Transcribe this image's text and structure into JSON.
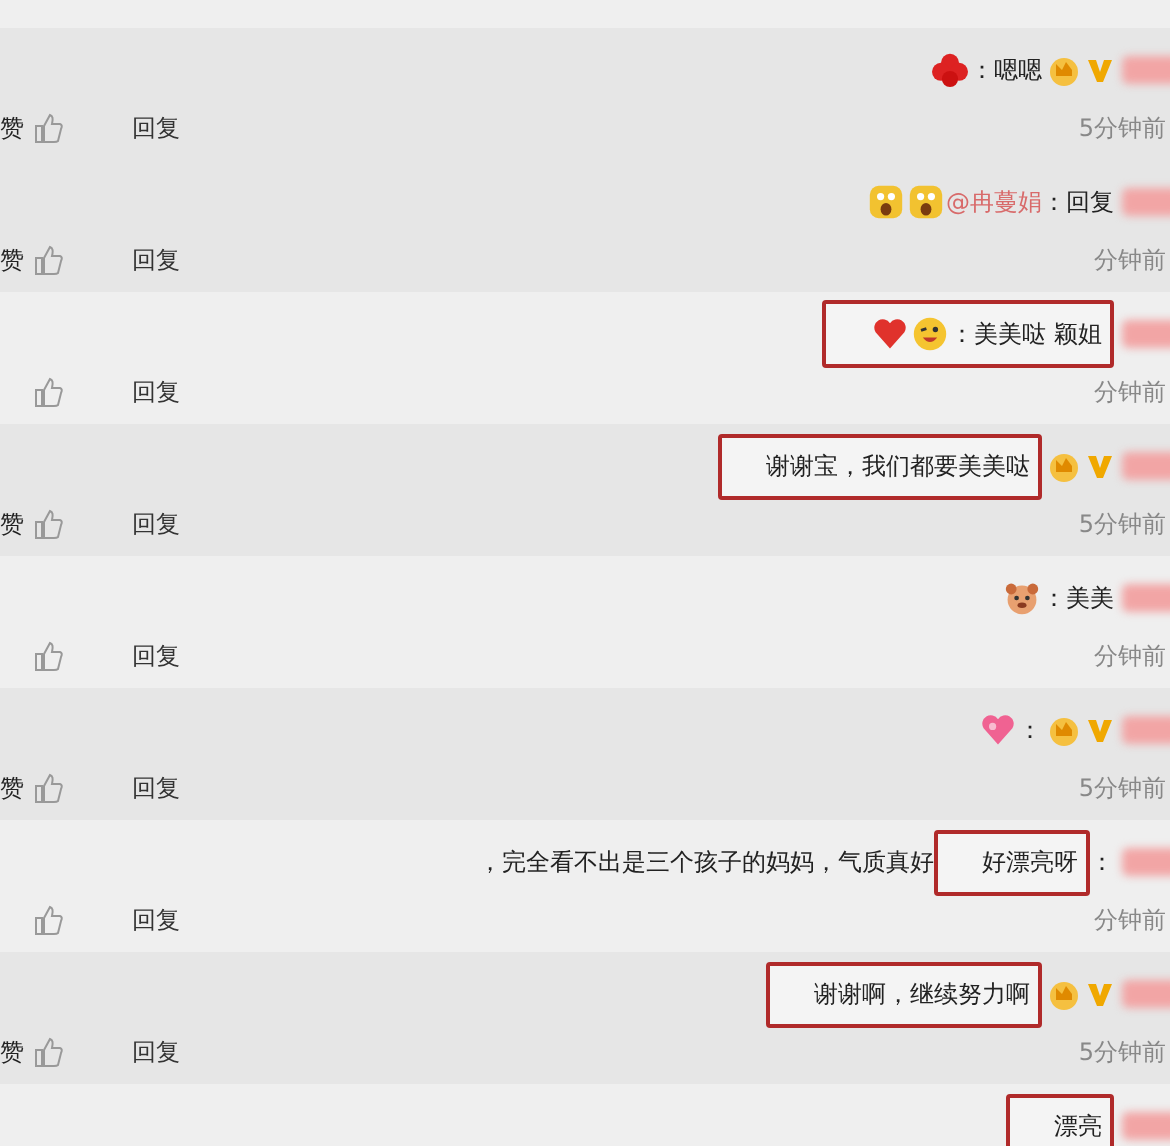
{
  "comments": [
    {
      "shaded": true,
      "verified": true,
      "member": true,
      "time": "5分钟前",
      "reply": "回复",
      "like": "赞",
      "body": [
        {
          "boxed": false,
          "items": [
            {
              "kind": "flower"
            },
            {
              "kind": "text",
              "text": "：嗯嗯"
            }
          ]
        }
      ]
    },
    {
      "shaded": true,
      "verified": false,
      "member": false,
      "time": "分钟前",
      "reply": "回复",
      "like": "赞",
      "body": [
        {
          "boxed": false,
          "items": [
            {
              "kind": "shock"
            },
            {
              "kind": "shock"
            },
            {
              "kind": "link",
              "text": "@冉蔓娟"
            },
            {
              "kind": "text",
              "text": "：回复"
            }
          ]
        }
      ]
    },
    {
      "shaded": false,
      "verified": false,
      "member": false,
      "time": "分钟前",
      "reply": "回复",
      "body": [
        {
          "boxed": true,
          "items": [
            {
              "kind": "heart"
            },
            {
              "kind": "wink"
            },
            {
              "kind": "text",
              "text": "：美美哒 颖姐"
            }
          ]
        }
      ]
    },
    {
      "shaded": true,
      "verified": true,
      "member": true,
      "time": "5分钟前",
      "reply": "回复",
      "like": "赞",
      "body": [
        {
          "boxed": true,
          "items": [
            {
              "kind": "text",
              "text": "谢谢宝，我们都要美美哒"
            }
          ]
        }
      ]
    },
    {
      "shaded": false,
      "verified": false,
      "member": false,
      "time": "分钟前",
      "reply": "回复",
      "body": [
        {
          "boxed": false,
          "items": [
            {
              "kind": "dog"
            },
            {
              "kind": "text",
              "text": "：美美"
            }
          ]
        }
      ]
    },
    {
      "shaded": true,
      "verified": true,
      "member": true,
      "time": "5分钟前",
      "reply": "回复",
      "like": "赞",
      "body": [
        {
          "boxed": false,
          "items": [
            {
              "kind": "lovely"
            },
            {
              "kind": "text",
              "text": "："
            }
          ]
        }
      ]
    },
    {
      "shaded": false,
      "verified": false,
      "member": false,
      "time": "分钟前",
      "reply": "回复",
      "body": [
        {
          "boxed": false,
          "items": [
            {
              "kind": "text",
              "text": "，完全看不出是三个孩子的妈妈，气质真好"
            }
          ]
        },
        {
          "boxed": true,
          "items": [
            {
              "kind": "text",
              "text": "好漂亮呀"
            }
          ]
        },
        {
          "boxed": false,
          "items": [
            {
              "kind": "text",
              "text": "："
            }
          ]
        }
      ]
    },
    {
      "shaded": true,
      "verified": true,
      "member": true,
      "time": "5分钟前",
      "reply": "回复",
      "like": "赞",
      "body": [
        {
          "boxed": true,
          "items": [
            {
              "kind": "text",
              "text": "谢谢啊，继续努力啊"
            }
          ]
        }
      ]
    },
    {
      "shaded": false,
      "verified": false,
      "member": false,
      "body": [
        {
          "boxed": true,
          "items": [
            {
              "kind": "text",
              "text": "漂亮"
            }
          ]
        }
      ]
    }
  ]
}
